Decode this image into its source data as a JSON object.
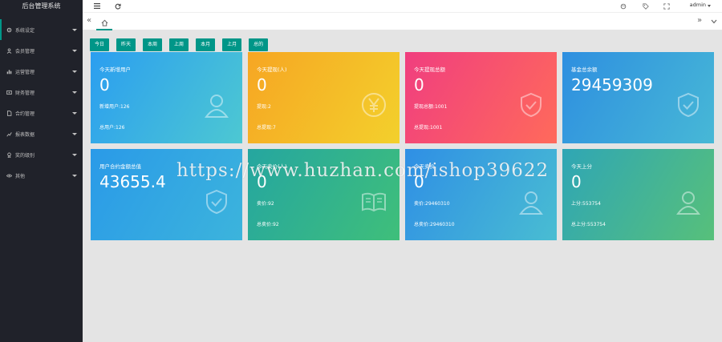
{
  "app": {
    "title": "后台管理系统",
    "user": "admin"
  },
  "sidebar": {
    "items": [
      {
        "label": "系统设定",
        "icon": "gear-icon"
      },
      {
        "label": "会员管理",
        "icon": "user-icon"
      },
      {
        "label": "运营管理",
        "icon": "chart-icon"
      },
      {
        "label": "财务管理",
        "icon": "money-icon"
      },
      {
        "label": "合约管理",
        "icon": "file-icon"
      },
      {
        "label": "报表数据",
        "icon": "report-icon"
      },
      {
        "label": "奖的级别",
        "icon": "award-icon"
      },
      {
        "label": "其他",
        "icon": "eye-icon"
      }
    ]
  },
  "filters": [
    "今日",
    "昨天",
    "本周",
    "上周",
    "本月",
    "上月",
    "总的"
  ],
  "cards": [
    {
      "title": "今天新增用户",
      "value": "0",
      "line1": "新增用户:126",
      "line2": "总用户:126",
      "icon": "user-icon"
    },
    {
      "title": "今天提现(人)",
      "value": "0",
      "line1": "提现:2",
      "line2": "总提现:7",
      "icon": "yen-icon"
    },
    {
      "title": "今天提现总额",
      "value": "0",
      "line1": "提现总额:1001",
      "line2": "总提现:1001",
      "icon": "shield-check-icon"
    },
    {
      "title": "基金总余额",
      "value": "29459309",
      "line1": "",
      "line2": "",
      "icon": "shield-check-icon"
    },
    {
      "title": "用户合约金额总值",
      "value": "43655.4",
      "line1": "",
      "line2": "",
      "icon": "shield-check-icon"
    },
    {
      "title": "今天卖价(人)",
      "value": "0",
      "line1": "卖价:92",
      "line2": "总卖价:92",
      "icon": "book-icon"
    },
    {
      "title": "今天卖价",
      "value": "0",
      "line1": "卖价:29460310",
      "line2": "总卖价:29460310",
      "icon": "user-icon"
    },
    {
      "title": "今天上分",
      "value": "0",
      "line1": "上分:553754",
      "line2": "总上分:553754",
      "icon": "user-icon"
    }
  ],
  "watermark": "https://www.huzhan.com/ishop39622"
}
